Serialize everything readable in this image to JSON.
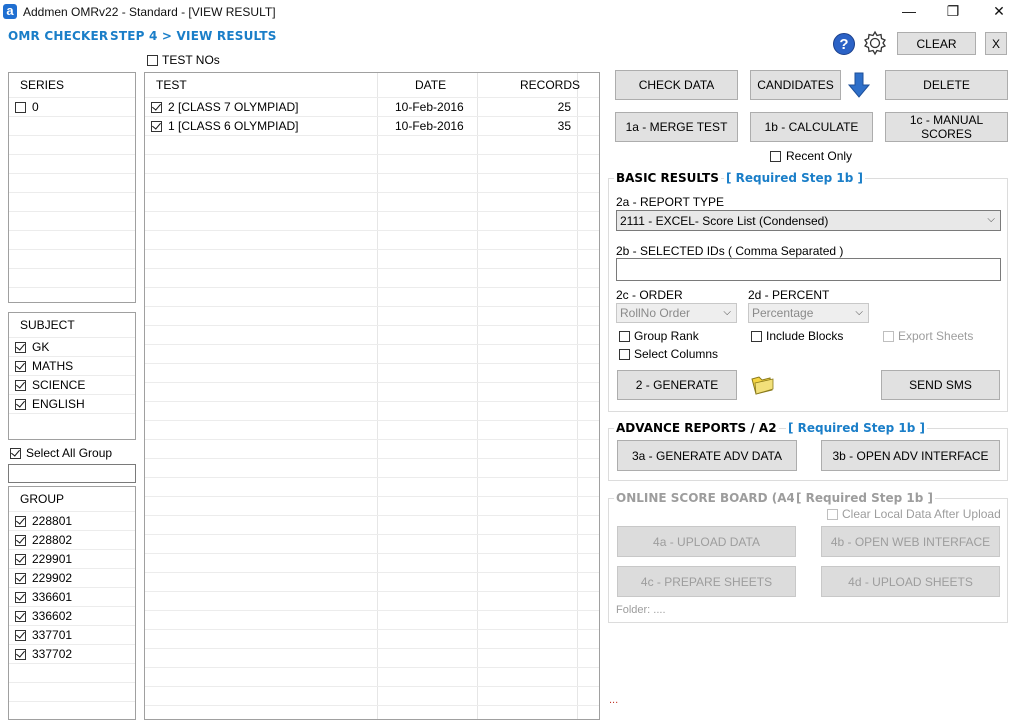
{
  "window": {
    "title": "Addmen OMRv22 - Standard - [VIEW RESULT]",
    "logo_letter": "a",
    "minimize": "—",
    "restore": "❐",
    "close": "✕"
  },
  "nav": {
    "omr_checker": "OMR CHECKER",
    "step": "STEP 4 > VIEW RESULTS"
  },
  "top_right": {
    "help": "?",
    "clear_label": "CLEAR",
    "x_label": "X"
  },
  "test_nos_label": "TEST NOs",
  "series": {
    "header": "SERIES",
    "items": [
      {
        "label": "0",
        "checked": false
      }
    ]
  },
  "subject": {
    "header": "SUBJECT",
    "items": [
      {
        "label": "GK",
        "checked": true
      },
      {
        "label": "MATHS",
        "checked": true
      },
      {
        "label": "SCIENCE",
        "checked": true
      },
      {
        "label": "ENGLISH",
        "checked": true
      }
    ]
  },
  "select_all_group": "Select All Group",
  "group": {
    "header": "GROUP",
    "items": [
      {
        "label": "228801",
        "checked": true
      },
      {
        "label": "228802",
        "checked": true
      },
      {
        "label": "229901",
        "checked": true
      },
      {
        "label": "229902",
        "checked": true
      },
      {
        "label": "336601",
        "checked": true
      },
      {
        "label": "336602",
        "checked": true
      },
      {
        "label": "337701",
        "checked": true
      },
      {
        "label": "337702",
        "checked": true
      }
    ]
  },
  "tests_table": {
    "columns": [
      "TEST",
      "DATE",
      "RECORDS"
    ],
    "rows": [
      {
        "test": "2 [CLASS 7 OLYMPIAD]",
        "date": "10-Feb-2016",
        "records": "25",
        "checked": true
      },
      {
        "test": "1 [CLASS 6 OLYMPIAD]",
        "date": "10-Feb-2016",
        "records": "35",
        "checked": true
      }
    ]
  },
  "actions": {
    "check_data": "CHECK DATA",
    "candidates": "CANDIDATES",
    "delete": "DELETE",
    "merge_test": "1a - MERGE TEST",
    "calculate": "1b - CALCULATE",
    "manual_scores": "1c - MANUAL SCORES",
    "recent_only": "Recent Only"
  },
  "basic": {
    "title": "BASIC RESULTS",
    "required": "[ Required Step 1b ]",
    "report_type_label": "2a - REPORT TYPE",
    "report_type_value": "2111 - EXCEL- Score List (Condensed)",
    "selected_ids_label": "2b - SELECTED IDs ( Comma Separated )",
    "selected_ids_value": "",
    "order_label": "2c - ORDER",
    "order_value": "RollNo Order",
    "percent_label": "2d - PERCENT",
    "percent_value": "Percentage",
    "group_rank": "Group Rank",
    "include_blocks": "Include Blocks",
    "export_sheets": "Export Sheets",
    "select_columns": "Select Columns",
    "generate": "2 - GENERATE",
    "send_sms": "SEND SMS"
  },
  "advance": {
    "title": "ADVANCE REPORTS / A2",
    "required": "[ Required Step 1b ]",
    "generate_adv": "3a - GENERATE ADV DATA",
    "open_adv": "3b - OPEN ADV INTERFACE"
  },
  "online": {
    "title": "ONLINE SCORE BOARD (A4)",
    "required": "[ Required Step 1b ]",
    "clear_local": "Clear Local Data After Upload",
    "upload_data": "4a - UPLOAD DATA",
    "open_web": "4b - OPEN WEB INTERFACE",
    "prepare_sheets": "4c - PREPARE SHEETS",
    "upload_sheets": "4d - UPLOAD SHEETS",
    "folder": "Folder: ...."
  },
  "footer_dots": "..."
}
